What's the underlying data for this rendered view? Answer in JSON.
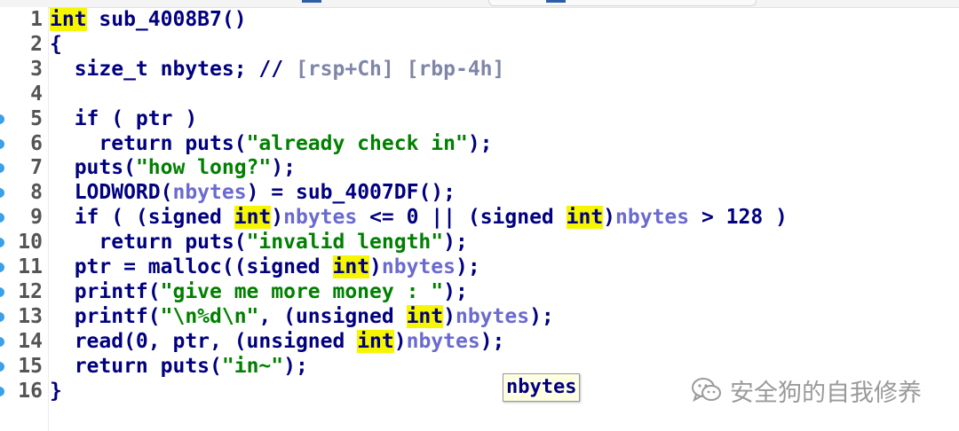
{
  "editor": {
    "lines": [
      {
        "num": "1",
        "tokens": [
          {
            "t": "int",
            "c": "hl"
          },
          {
            "t": " sub_4008B7()",
            "c": "kw"
          }
        ]
      },
      {
        "num": "2",
        "tokens": [
          {
            "t": "{",
            "c": "kw"
          }
        ]
      },
      {
        "num": "3",
        "tokens": [
          {
            "t": "  size_t nbytes; // ",
            "c": "kw"
          },
          {
            "t": "[rsp+Ch] [rbp-4h]",
            "c": "cmt"
          }
        ]
      },
      {
        "num": "4",
        "tokens": []
      },
      {
        "num": "5",
        "tokens": [
          {
            "t": "  if ( ptr )",
            "c": "kw"
          }
        ],
        "bp": true
      },
      {
        "num": "6",
        "tokens": [
          {
            "t": "    return puts(",
            "c": "kw"
          },
          {
            "t": "\"already check in\"",
            "c": "str"
          },
          {
            "t": ");",
            "c": "kw"
          }
        ],
        "bp": true
      },
      {
        "num": "7",
        "tokens": [
          {
            "t": "  puts(",
            "c": "kw"
          },
          {
            "t": "\"how long?\"",
            "c": "str"
          },
          {
            "t": ");",
            "c": "kw"
          }
        ],
        "bp": true
      },
      {
        "num": "8",
        "tokens": [
          {
            "t": "  LODWORD(",
            "c": "kw"
          },
          {
            "t": "nbytes",
            "c": "var"
          },
          {
            "t": ") = sub_4007DF();",
            "c": "kw"
          }
        ],
        "bp": true
      },
      {
        "num": "9",
        "tokens": [
          {
            "t": "  if ( (signed ",
            "c": "kw"
          },
          {
            "t": "int",
            "c": "hl"
          },
          {
            "t": ")",
            "c": "kw"
          },
          {
            "t": "nbytes",
            "c": "var"
          },
          {
            "t": " <= 0 || (signed ",
            "c": "kw"
          },
          {
            "t": "int",
            "c": "hl"
          },
          {
            "t": ")",
            "c": "kw"
          },
          {
            "t": "nbytes",
            "c": "var"
          },
          {
            "t": " > 128 )",
            "c": "kw"
          }
        ],
        "bp": true
      },
      {
        "num": "10",
        "tokens": [
          {
            "t": "    return puts(",
            "c": "kw"
          },
          {
            "t": "\"invalid length\"",
            "c": "str"
          },
          {
            "t": ");",
            "c": "kw"
          }
        ],
        "bp": true
      },
      {
        "num": "11",
        "tokens": [
          {
            "t": "  ptr = malloc((signed ",
            "c": "kw"
          },
          {
            "t": "int",
            "c": "hl"
          },
          {
            "t": ")",
            "c": "kw"
          },
          {
            "t": "nbytes",
            "c": "var"
          },
          {
            "t": ");",
            "c": "kw"
          }
        ],
        "bp": true
      },
      {
        "num": "12",
        "tokens": [
          {
            "t": "  printf(",
            "c": "kw"
          },
          {
            "t": "\"give me more money : \"",
            "c": "str"
          },
          {
            "t": ");",
            "c": "kw"
          }
        ],
        "bp": true
      },
      {
        "num": "13",
        "tokens": [
          {
            "t": "  printf(",
            "c": "kw"
          },
          {
            "t": "\"\\n%d\\n\"",
            "c": "str"
          },
          {
            "t": ", (unsigned ",
            "c": "kw"
          },
          {
            "t": "int",
            "c": "hl"
          },
          {
            "t": ")",
            "c": "kw"
          },
          {
            "t": "nbytes",
            "c": "var"
          },
          {
            "t": ");",
            "c": "kw"
          }
        ],
        "bp": true
      },
      {
        "num": "14",
        "tokens": [
          {
            "t": "  read(0, ptr, (unsigned ",
            "c": "kw"
          },
          {
            "t": "int",
            "c": "hl"
          },
          {
            "t": ")",
            "c": "kw"
          },
          {
            "t": "nbytes",
            "c": "var"
          },
          {
            "t": ");",
            "c": "kw"
          }
        ],
        "bp": true
      },
      {
        "num": "15",
        "tokens": [
          {
            "t": "  return puts(",
            "c": "kw"
          },
          {
            "t": "\"in~\"",
            "c": "str"
          },
          {
            "t": ");",
            "c": "kw"
          }
        ],
        "bp": true
      },
      {
        "num": "16",
        "tokens": [
          {
            "t": "}",
            "c": "kw"
          }
        ],
        "bp": true
      }
    ]
  },
  "tooltip": {
    "text": "nbytes"
  },
  "watermark": {
    "text": "安全狗的自我修养",
    "icon": "wechat-icon"
  },
  "colors": {
    "keyword": "#000080",
    "highlight": "#f6f600",
    "variable": "#6a6ad0",
    "string": "#008000",
    "comment": "#7f86a6",
    "breakpoint": "#3aa0e8"
  }
}
